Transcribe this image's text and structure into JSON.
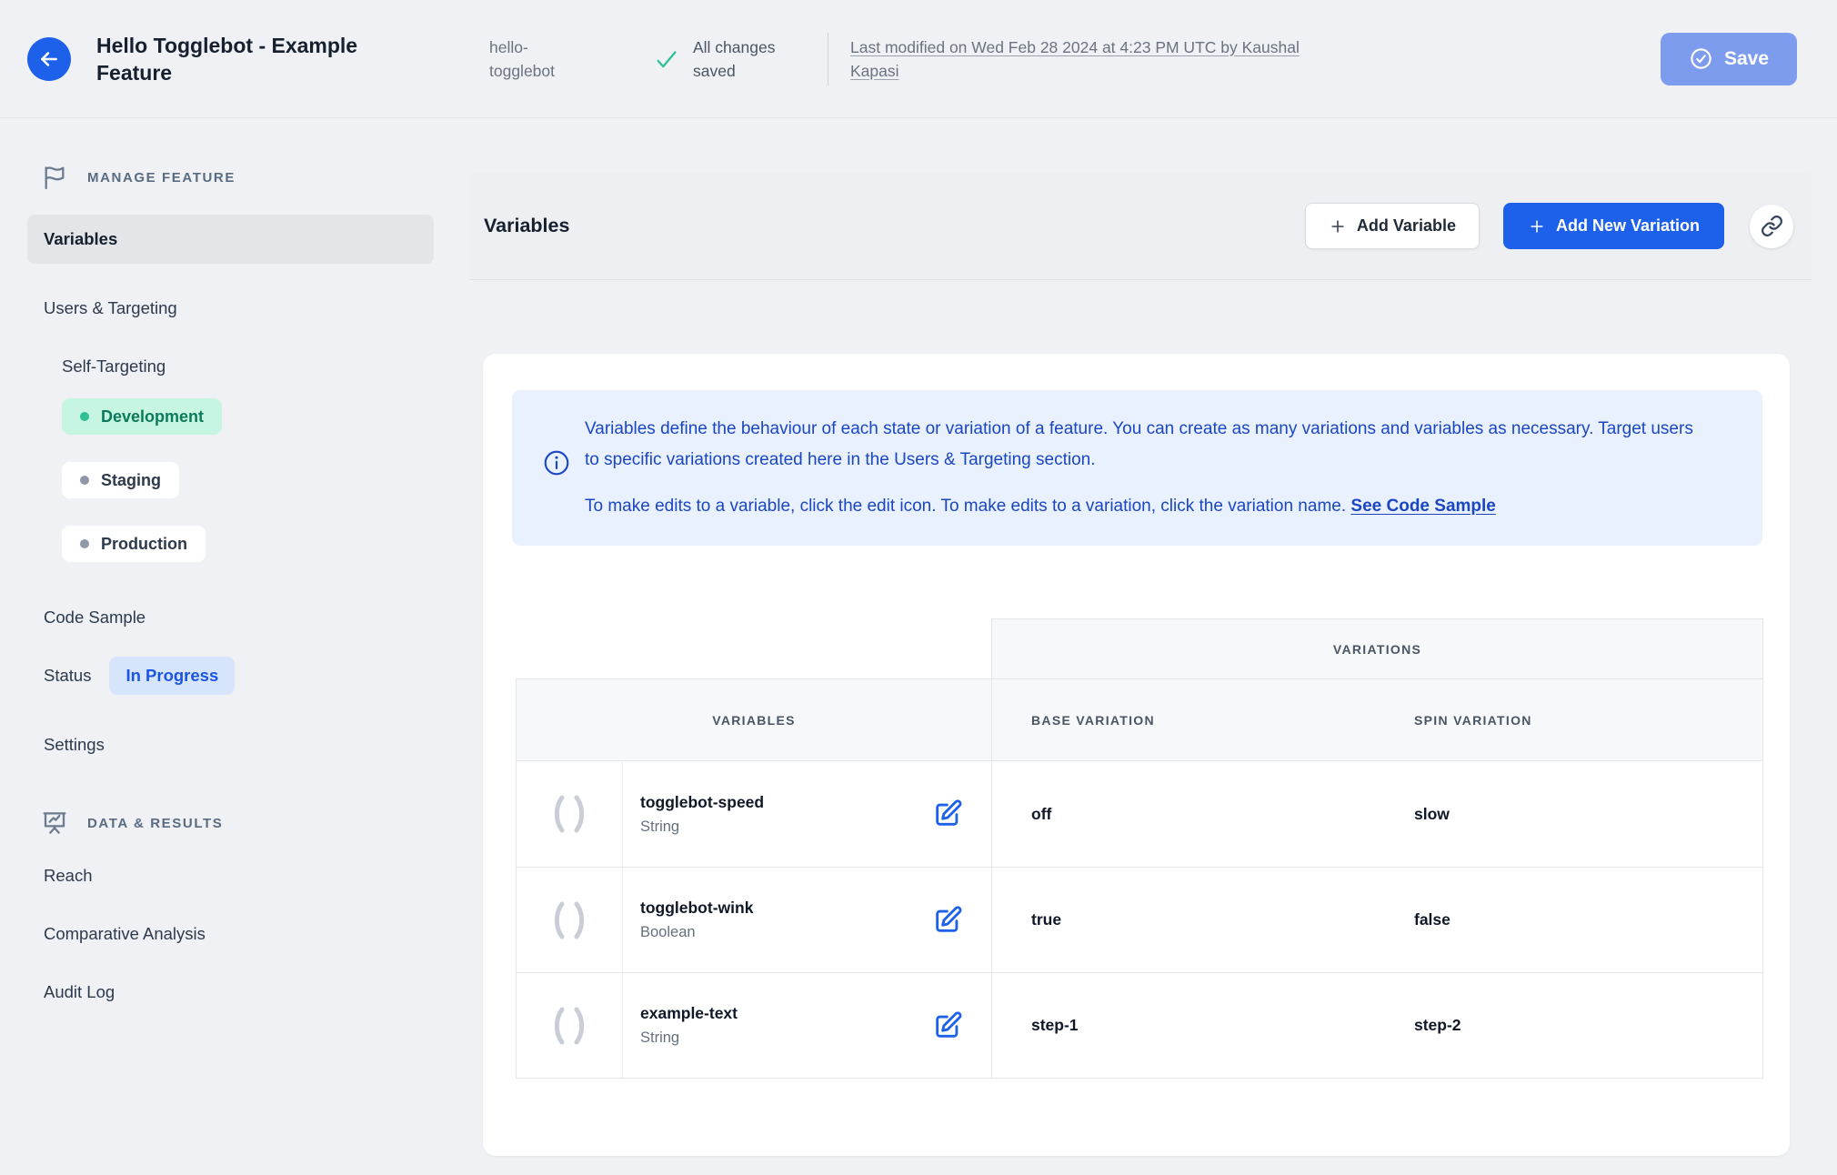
{
  "header": {
    "title": "Hello Togglebot - Example Feature",
    "feature_key": "hello-togglebot",
    "saved_status": "All changes saved",
    "last_modified": "Last modified on Wed Feb 28 2024 at 4:23 PM UTC by Kaushal Kapasi",
    "save_label": "Save"
  },
  "sidebar": {
    "manage_section_label": "MANAGE FEATURE",
    "data_section_label": "DATA & RESULTS",
    "items": [
      {
        "label": "Variables",
        "selected": true
      },
      {
        "label": "Users & Targeting"
      },
      {
        "label": "Self-Targeting"
      },
      {
        "label": "Development",
        "env_state": "active"
      },
      {
        "label": "Staging",
        "env_state": "inactive"
      },
      {
        "label": "Production",
        "env_state": "inactive"
      },
      {
        "label": "Code Sample"
      },
      {
        "label": "Status"
      },
      {
        "label": "Settings"
      },
      {
        "label": "Reach"
      },
      {
        "label": "Comparative Analysis"
      },
      {
        "label": "Audit Log"
      }
    ],
    "status_badge": "In Progress"
  },
  "toolbar": {
    "title": "Variables",
    "add_variable_label": "Add Variable",
    "add_new_variation_label": "Add New Variation"
  },
  "infobox": {
    "paragraph1": "Variables define the behaviour of each state or variation of a feature. You can create as many variations and variables as necessary. Target users to specific variations created here in the Users & Targeting section.",
    "paragraph2": "To make edits to a variable, click the edit icon. To make edits to a variation, click the variation name. ",
    "link_label": "See Code Sample"
  },
  "table": {
    "group_header": "VARIATIONS",
    "columns": {
      "variables": "VARIABLES",
      "base": "BASE VARIATION",
      "spin": "SPIN VARIATION"
    },
    "rows": [
      {
        "name": "togglebot-speed",
        "type": "String",
        "base": "off",
        "spin": "slow"
      },
      {
        "name": "togglebot-wink",
        "type": "Boolean",
        "base": "true",
        "spin": "false"
      },
      {
        "name": "example-text",
        "type": "String",
        "base": "step-1",
        "spin": "step-2"
      }
    ]
  },
  "icons": {
    "back": "arrow-left-icon",
    "saved": "check-icon",
    "save": "check-circle-icon",
    "manage_section": "flag-icon",
    "data_section": "presentation-chart-icon",
    "add": "plus-icon",
    "share": "link-icon",
    "info": "info-circle-icon",
    "variable": "parentheses-icon",
    "edit": "edit-pencil-square-icon"
  },
  "colors": {
    "accent_blue": "#1d60ea",
    "save_disabled_blue": "#7e9ced",
    "success_teal": "#2fbf96",
    "info_bg": "#e8f1fd",
    "info_text": "#1b46c2",
    "dev_badge_bg": "#c6f5e1",
    "dev_badge_text": "#0c7a5b",
    "status_badge_bg": "#d7e5fc",
    "status_badge_text": "#1b56e0",
    "page_bg": "#eff1f4"
  }
}
